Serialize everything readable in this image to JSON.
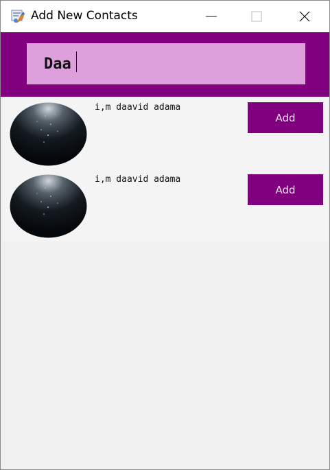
{
  "window": {
    "title": "Add New Contacts",
    "controls": {
      "minimize_icon": "minimize-icon",
      "maximize_icon": "maximize-icon",
      "close_icon": "close-icon"
    }
  },
  "search": {
    "value": "Daa",
    "background_color": "#dda0dd",
    "band_color": "#800080"
  },
  "results": [
    {
      "name": "i,m daavid adama",
      "button_label": "Add",
      "avatar_icon": "avatar-image"
    },
    {
      "name": "i,m daavid adama",
      "button_label": "Add",
      "avatar_icon": "avatar-image"
    }
  ],
  "colors": {
    "accent": "#800080",
    "input": "#dda0dd"
  }
}
